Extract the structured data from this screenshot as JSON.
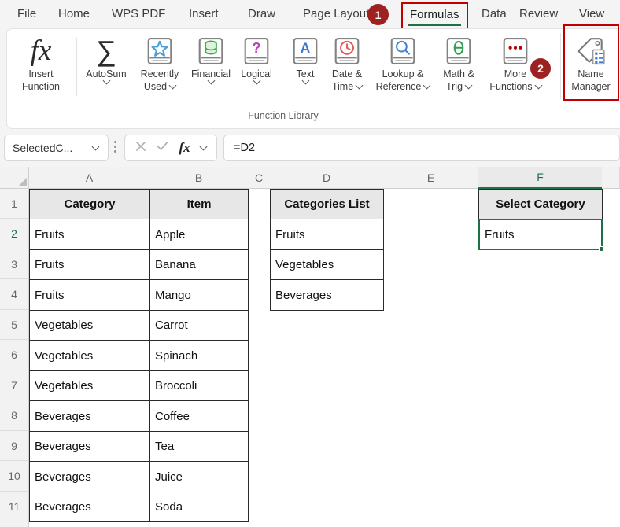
{
  "menu": {
    "items": [
      {
        "label": "File"
      },
      {
        "label": "Home"
      },
      {
        "label": "WPS PDF"
      },
      {
        "label": "Insert"
      },
      {
        "label": "Draw"
      },
      {
        "label": "Page Layout"
      },
      {
        "label": "Formulas",
        "active": true
      },
      {
        "label": "Data"
      },
      {
        "label": "Review"
      },
      {
        "label": "View"
      }
    ]
  },
  "annotations": {
    "step1": "1",
    "step2": "2"
  },
  "ribbon": {
    "group_label": "Function Library",
    "glyphs": {
      "insert_function": "fx",
      "autosum": "∑",
      "logical": "?",
      "text": "A",
      "math_trig": "θ"
    },
    "buttons": [
      {
        "label1": "Insert",
        "label2": "Function"
      },
      {
        "label1": "AutoSum",
        "label2": ""
      },
      {
        "label1": "Recently",
        "label2": "Used"
      },
      {
        "label1": "Financial",
        "label2": ""
      },
      {
        "label1": "Logical",
        "label2": ""
      },
      {
        "label1": "Text",
        "label2": ""
      },
      {
        "label1": "Date &",
        "label2": "Time"
      },
      {
        "label1": "Lookup &",
        "label2": "Reference"
      },
      {
        "label1": "Math &",
        "label2": "Trig"
      },
      {
        "label1": "More",
        "label2": "Functions"
      },
      {
        "label1": "Name",
        "label2": "Manager"
      }
    ]
  },
  "formula_bar": {
    "name_box": "SelectedC...",
    "fx_label": "fx",
    "formula": "=D2"
  },
  "grid": {
    "column_headers": [
      "A",
      "B",
      "C",
      "D",
      "E",
      "F"
    ],
    "row_headers": [
      "1",
      "2",
      "3",
      "4",
      "5",
      "6",
      "7",
      "8",
      "9",
      "10",
      "11"
    ],
    "selected_column": "F",
    "selected_row": "2",
    "category_table": {
      "headers": [
        "Category",
        "Item"
      ],
      "rows": [
        [
          "Fruits",
          "Apple"
        ],
        [
          "Fruits",
          "Banana"
        ],
        [
          "Fruits",
          "Mango"
        ],
        [
          "Vegetables",
          "Carrot"
        ],
        [
          "Vegetables",
          "Spinach"
        ],
        [
          "Vegetables",
          "Broccoli"
        ],
        [
          "Beverages",
          "Coffee"
        ],
        [
          "Beverages",
          "Tea"
        ],
        [
          "Beverages",
          "Juice"
        ],
        [
          "Beverages",
          "Soda"
        ]
      ]
    },
    "categories_list": {
      "header": "Categories List",
      "items": [
        "Fruits",
        "Vegetables",
        "Beverages"
      ]
    },
    "select_category": {
      "header": "Select Category",
      "value": "Fruits"
    }
  },
  "colors": {
    "excel_green": "#1e7145",
    "annotation_red": "#9e2121",
    "callout_red": "#c00000"
  }
}
